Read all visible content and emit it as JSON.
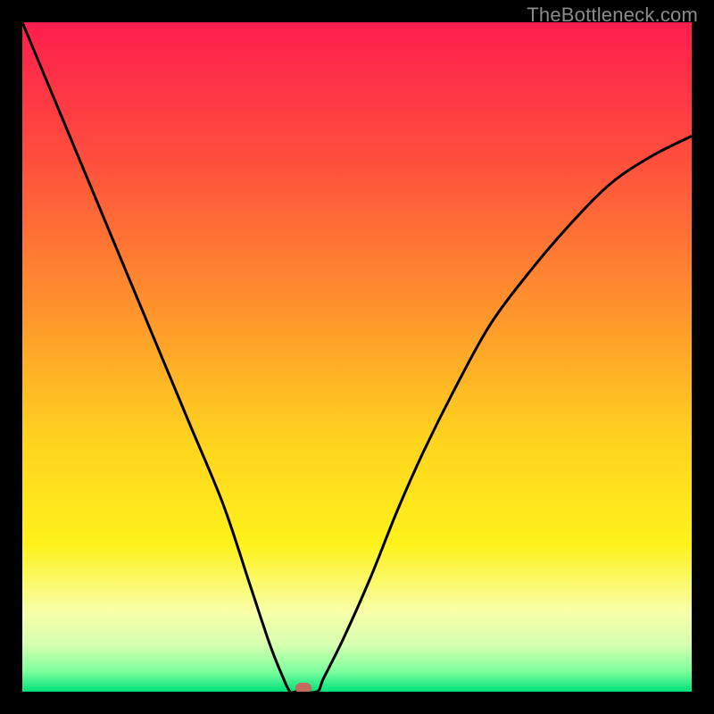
{
  "watermark": {
    "text": "TheBottleneck.com"
  },
  "chart_data": {
    "type": "line",
    "title": "",
    "xlabel": "",
    "ylabel": "",
    "xlim": [
      0,
      100
    ],
    "ylim": [
      0,
      100
    ],
    "series": [
      {
        "name": "bottleneck-curve",
        "x": [
          0,
          5,
          10,
          15,
          20,
          25,
          30,
          34,
          37,
          39,
          40,
          41,
          44,
          45,
          48,
          52,
          56,
          60,
          65,
          70,
          76,
          82,
          88,
          94,
          100
        ],
        "y": [
          100,
          88,
          76,
          64,
          52,
          40,
          28,
          16,
          7,
          2,
          0,
          0,
          0,
          2,
          8,
          17,
          27,
          36,
          46,
          55,
          63,
          70,
          76,
          80,
          83
        ]
      }
    ],
    "plateau_x": [
      40,
      44
    ],
    "marker": {
      "x": 42,
      "y": 0,
      "color": "#c46a5e"
    },
    "gradient_stops": [
      {
        "pct": 0,
        "color": "#ff1d4d"
      },
      {
        "pct": 20,
        "color": "#ff4d3d"
      },
      {
        "pct": 45,
        "color": "#ff9a2b"
      },
      {
        "pct": 62,
        "color": "#ffd21f"
      },
      {
        "pct": 78,
        "color": "#fff21a"
      },
      {
        "pct": 88,
        "color": "#f8ffa8"
      },
      {
        "pct": 93,
        "color": "#d6ffb0"
      },
      {
        "pct": 97,
        "color": "#7dff9e"
      },
      {
        "pct": 100,
        "color": "#00e07a"
      }
    ]
  }
}
